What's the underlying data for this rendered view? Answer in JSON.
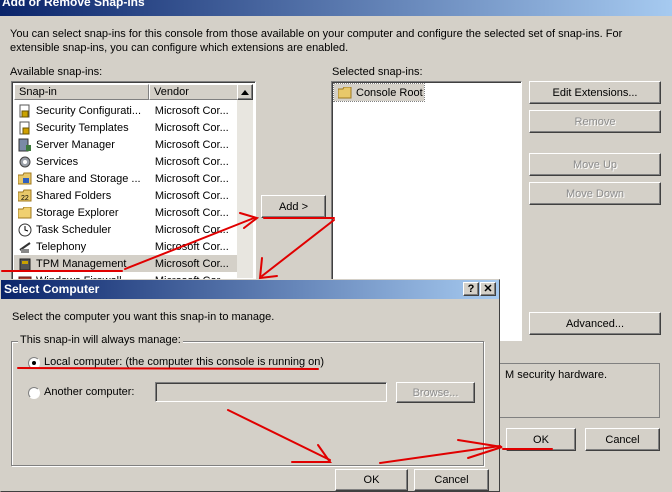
{
  "main_dialog": {
    "title": "Add or Remove Snap-ins",
    "description": "You can select snap-ins for this console from those available on your computer and configure the selected set of snap-ins. For extensible snap-ins, you can configure which extensions are enabled.",
    "available_label": "Available snap-ins:",
    "selected_label": "Selected snap-ins:",
    "columns": {
      "snapin": "Snap-in",
      "vendor": "Vendor"
    },
    "available_items": [
      {
        "name": "Security Configurati...",
        "vendor": "Microsoft Cor...",
        "icon": "security-config-icon"
      },
      {
        "name": "Security Templates",
        "vendor": "Microsoft Cor...",
        "icon": "security-templates-icon"
      },
      {
        "name": "Server Manager",
        "vendor": "Microsoft Cor...",
        "icon": "server-manager-icon"
      },
      {
        "name": "Services",
        "vendor": "Microsoft Cor...",
        "icon": "services-gear-icon"
      },
      {
        "name": "Share and Storage ...",
        "vendor": "Microsoft Cor...",
        "icon": "share-storage-icon"
      },
      {
        "name": "Shared Folders",
        "vendor": "Microsoft Cor...",
        "icon": "shared-folders-icon"
      },
      {
        "name": "Storage Explorer",
        "vendor": "Microsoft Cor...",
        "icon": "folder-icon"
      },
      {
        "name": "Task Scheduler",
        "vendor": "Microsoft Cor...",
        "icon": "clock-icon"
      },
      {
        "name": "Telephony",
        "vendor": "Microsoft Cor...",
        "icon": "telephony-icon"
      },
      {
        "name": "TPM Management",
        "vendor": "Microsoft Cor...",
        "icon": "tpm-chip-icon"
      },
      {
        "name": "Windows Firewall",
        "vendor": "Microsoft Cor...",
        "icon": "firewall-icon"
      }
    ],
    "selected_items": [
      {
        "name": "Console Root",
        "icon": "folder-icon"
      }
    ],
    "add_button": "Add >",
    "buttons": {
      "edit_extensions": "Edit Extensions...",
      "remove": "Remove",
      "move_up": "Move Up",
      "move_down": "Move Down",
      "advanced": "Advanced...",
      "ok": "OK",
      "cancel": "Cancel"
    },
    "description_partial": "M security hardware."
  },
  "select_computer": {
    "title": "Select Computer",
    "help_button": "?",
    "close_button": "✕",
    "instruction": "Select the computer you want this snap-in to manage.",
    "group_label": "This snap-in will always manage:",
    "local_option": "Local computer:  (the computer this console is running on)",
    "local_selected": true,
    "another_option": "Another computer:",
    "another_value": "",
    "browse_button": "Browse...",
    "ok_button": "OK",
    "cancel_button": "Cancel"
  },
  "colors": {
    "title_bar_start": "#0a246a",
    "title_bar_end": "#a6caf0",
    "annotation_red": "#e00000",
    "window_face": "#d4d0c8"
  }
}
